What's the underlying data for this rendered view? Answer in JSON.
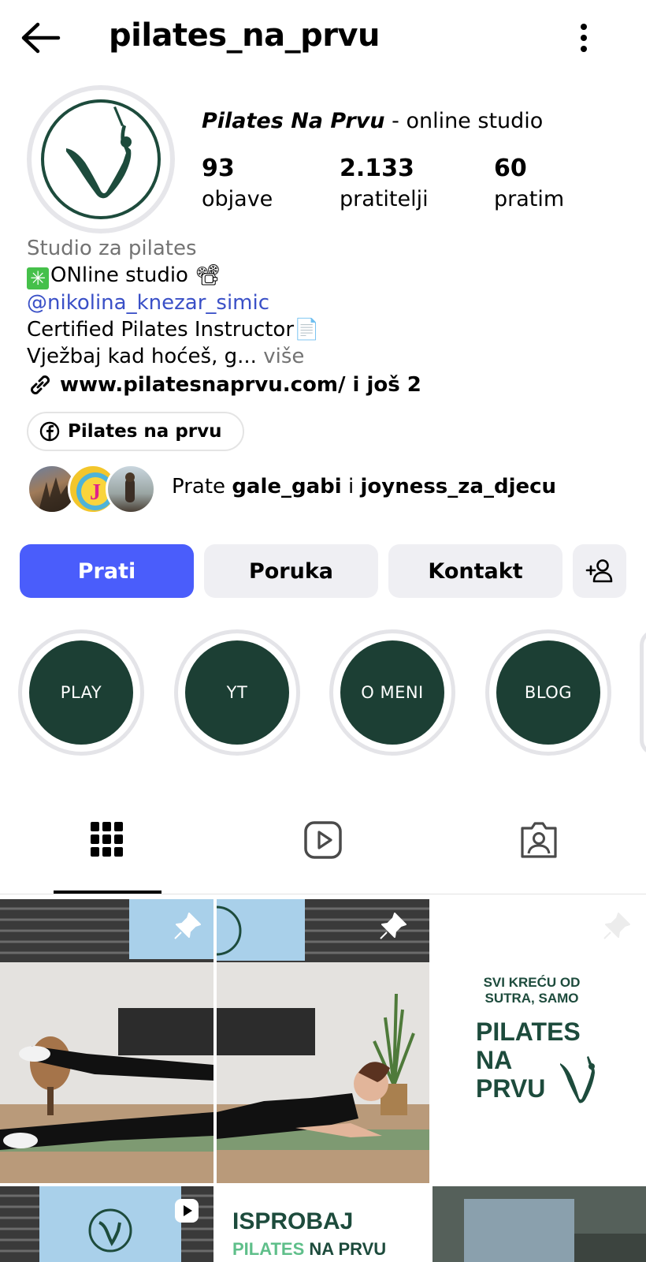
{
  "header": {
    "username": "pilates_na_prvu"
  },
  "profile": {
    "display_name": "Pilates Na Prvu",
    "name_suffix": " - online studio",
    "stats": [
      {
        "value": "93",
        "label": "objave"
      },
      {
        "value": "2.133",
        "label": "pratitelji"
      },
      {
        "value": "60",
        "label": "pratim"
      }
    ],
    "category": "Studio za pilates",
    "bio_line_1_icon": "✳",
    "bio_line_1": "ONline studio 📽",
    "mention": "@nikolina_knezar_simic",
    "mention_text": "nikolina_knezar_simic",
    "bio_line_3": "Certified Pilates Instructor📄",
    "bio_line_4": "Vježbaj kad hoćeš, g...",
    "more_label": " više",
    "link_text": "www.pilatesnaprvu.com/ i još 2",
    "facebook_chip": "Pilates na prvu",
    "followed_by_prefix": "Prate ",
    "followed_by_user_1": "gale_gabi",
    "followed_by_joiner": " i ",
    "followed_by_user_2": "joyness_za_djecu"
  },
  "actions": {
    "follow": "Prati",
    "message": "Poruka",
    "contact": "Kontakt"
  },
  "highlights": [
    "PLAY",
    "YT",
    "O MENI",
    "BLOG"
  ],
  "posts": {
    "post3_line1": "SVI KREĆU OD",
    "post3_line2": "SUTRA, SAMO",
    "post3_big1": "PILATES",
    "post3_big2": "NA",
    "post3_big3": "PRVU",
    "post5_line1": "ISPROBAJ",
    "post5_line2a": "PILATES",
    "post5_line2b": " NA PRVU"
  },
  "colors": {
    "primary_button": "#4a5dfb",
    "brand_green": "#1c3f34",
    "mention": "#3a50c7"
  },
  "icons": {
    "back": "back-arrow-icon",
    "menu": "more-vertical-icon",
    "link": "link-icon",
    "facebook": "facebook-icon",
    "add_person": "add-person-icon",
    "grid_tab": "grid-icon",
    "reels_tab": "reels-icon",
    "tagged_tab": "tagged-icon",
    "pin": "pin-icon"
  }
}
